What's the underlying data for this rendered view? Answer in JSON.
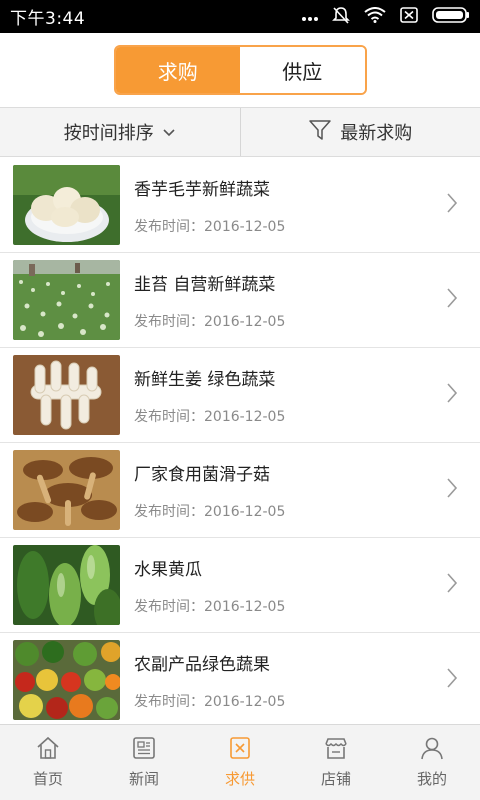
{
  "status_bar": {
    "time": "下午3:44",
    "icons": [
      "dots-icon",
      "mute-icon",
      "wifi-icon",
      "sim-icon",
      "battery-icon"
    ]
  },
  "segment": {
    "tabs": [
      {
        "label": "求购",
        "active": true
      },
      {
        "label": "供应",
        "active": false
      }
    ],
    "accent": "#f79a34"
  },
  "filter": {
    "sort_label": "按时间排序",
    "latest_label": "最新求购"
  },
  "list": {
    "items": [
      {
        "title": "香芋毛芋新鲜蔬菜",
        "date_label": "发布时间：2016-12-05",
        "image": "taro-photo"
      },
      {
        "title": "韭苔 自营新鲜蔬菜",
        "date_label": "发布时间：2016-12-05",
        "image": "chive-field-photo"
      },
      {
        "title": "新鲜生姜 绿色蔬菜",
        "date_label": "发布时间：2016-12-05",
        "image": "ginger-photo"
      },
      {
        "title": "厂家食用菌滑子菇",
        "date_label": "发布时间：2016-12-05",
        "image": "mushroom-photo"
      },
      {
        "title": "水果黄瓜",
        "date_label": "发布时间：2016-12-05",
        "image": "cucumber-photo"
      },
      {
        "title": "农副产品绿色蔬果",
        "date_label": "发布时间：2016-12-05",
        "image": "vegetables-photo"
      }
    ]
  },
  "bottom_nav": {
    "items": [
      {
        "label": "首页",
        "icon": "home-icon",
        "active": false
      },
      {
        "label": "新闻",
        "icon": "news-icon",
        "active": false
      },
      {
        "label": "求供",
        "icon": "supply-icon",
        "active": true
      },
      {
        "label": "店铺",
        "icon": "store-icon",
        "active": false
      },
      {
        "label": "我的",
        "icon": "user-icon",
        "active": false
      }
    ]
  }
}
